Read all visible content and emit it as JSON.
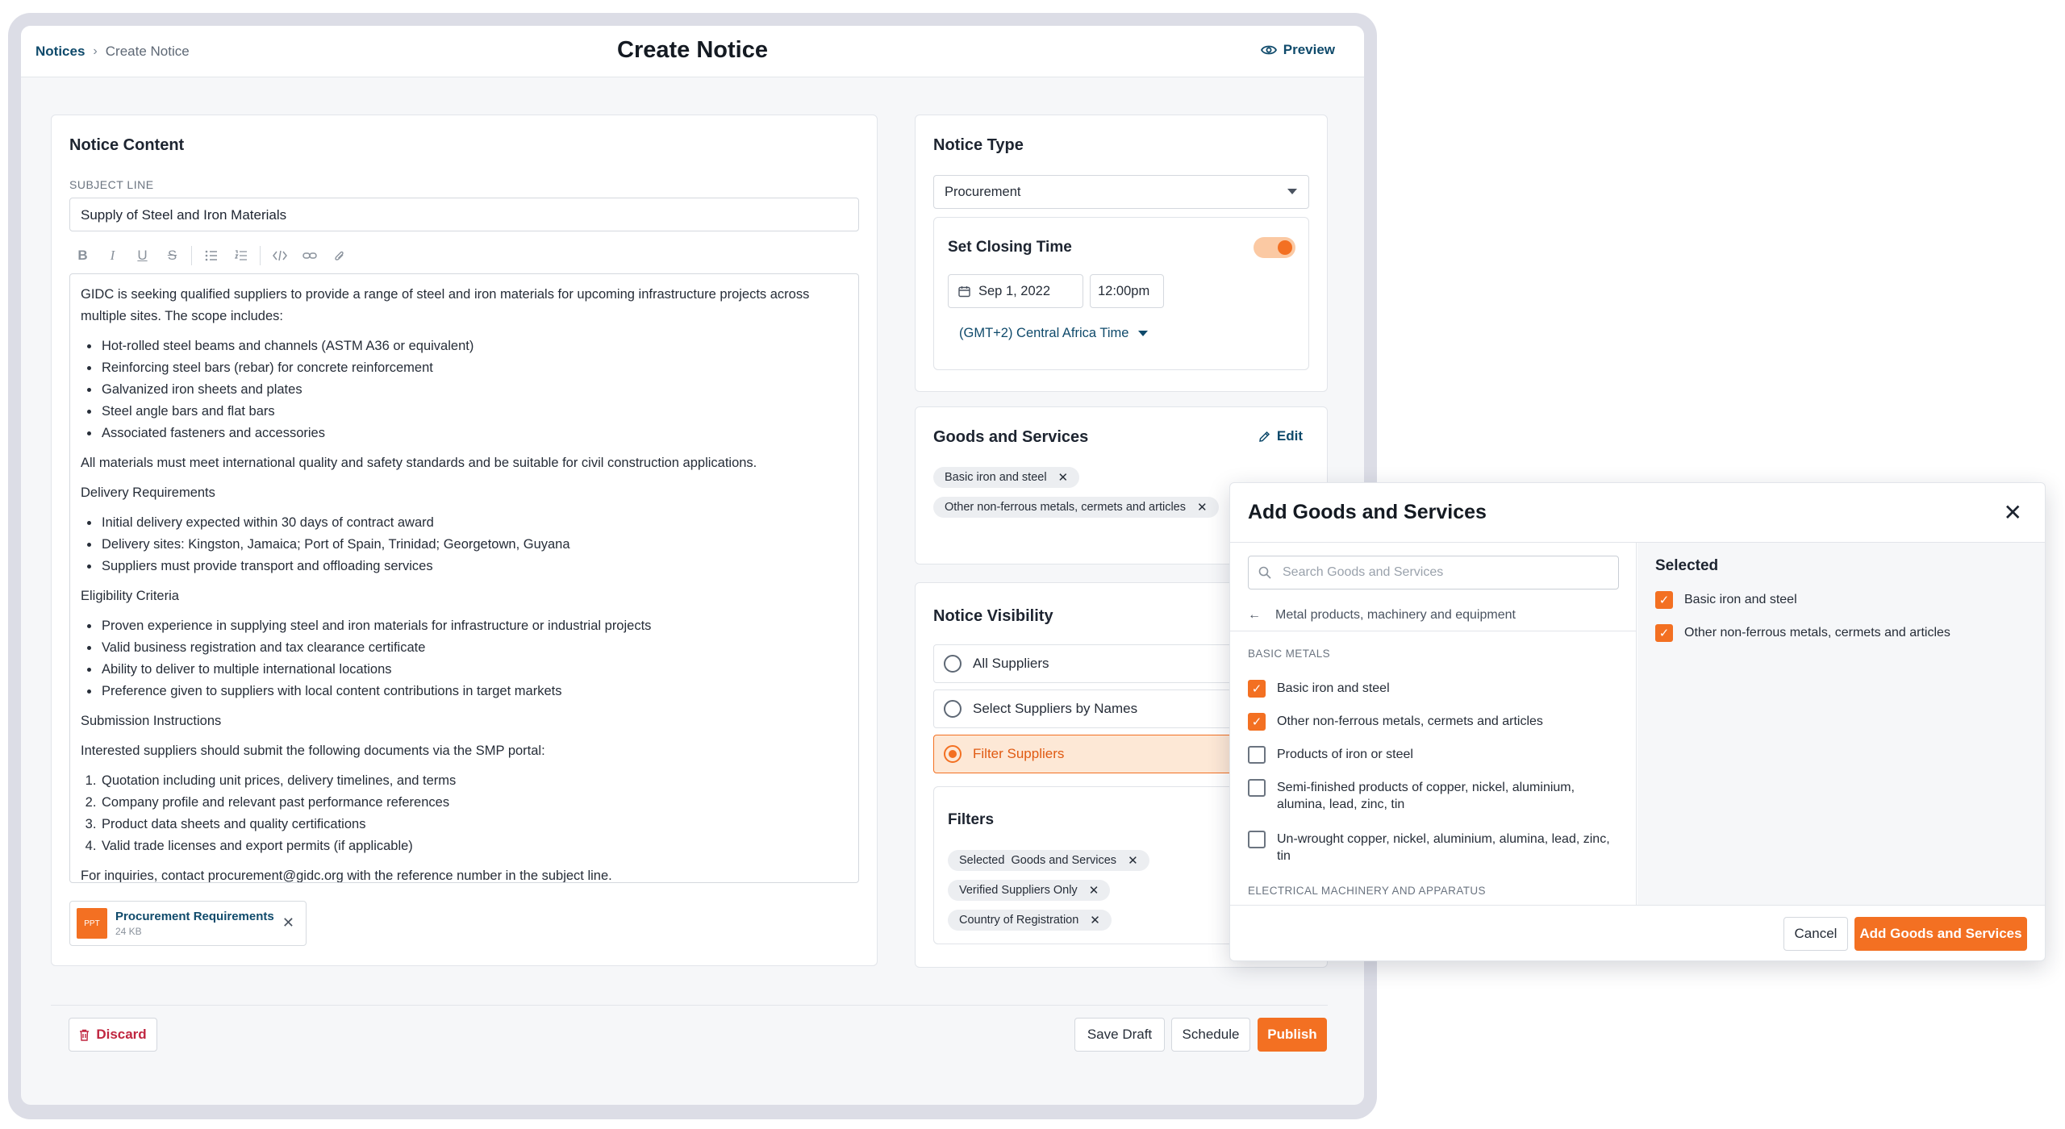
{
  "header": {
    "breadcrumb_root": "Notices",
    "breadcrumb_current": "Create Notice",
    "title": "Create Notice",
    "preview_label": "Preview"
  },
  "content": {
    "title": "Notice Content",
    "subject_label": "SUBJECT LINE",
    "subject_value": "Supply of Steel and Iron Materials",
    "toolbar_icons": [
      "bold-icon",
      "italic-icon",
      "underline-icon",
      "strikethrough-icon",
      "bullet-list-icon",
      "numbered-list-icon",
      "code-icon",
      "link-icon",
      "attachment-icon"
    ],
    "body": {
      "intro": "GIDC is seeking qualified suppliers to provide a range of steel and iron materials for upcoming infrastructure projects across multiple sites. The scope includes:",
      "scope": [
        "Hot-rolled steel beams and channels (ASTM A36 or equivalent)",
        "Reinforcing steel bars (rebar) for concrete reinforcement",
        "Galvanized iron sheets and plates",
        "Steel angle bars and flat bars",
        "Associated fasteners and accessories"
      ],
      "standards": "All materials must meet international quality and safety standards and be suitable for civil construction applications.",
      "delivery_heading": "Delivery Requirements",
      "delivery": [
        "Initial delivery expected within 30 days of contract award",
        "Delivery sites: Kingston, Jamaica; Port of Spain, Trinidad; Georgetown, Guyana",
        "Suppliers must provide transport and offloading services"
      ],
      "eligibility_heading": "Eligibility Criteria",
      "eligibility": [
        "Proven experience in supplying steel and iron materials for infrastructure or industrial projects",
        "Valid business registration and tax clearance certificate",
        "Ability to deliver to multiple international locations",
        "Preference given to suppliers with local content contributions in target markets"
      ],
      "submission_heading": "Submission Instructions",
      "submission_intro": "Interested suppliers should submit the following documents via the SMP portal:",
      "submission": [
        "Quotation including unit prices, delivery timelines, and terms",
        "Company profile and relevant past performance references",
        "Product data sheets and quality certifications",
        "Valid trade licenses and export permits (if applicable)"
      ],
      "inquiries": "For inquiries, contact procurement@gidc.org with the reference number in the subject line."
    },
    "attachment": {
      "type": "PPT",
      "name": "Procurement Requirements",
      "size": "24 KB"
    }
  },
  "notice_type": {
    "title": "Notice Type",
    "selected": "Procurement",
    "closing_title": "Set Closing Time",
    "closing_enabled": true,
    "date": "Sep 1, 2022",
    "time": "12:00pm",
    "timezone": "(GMT+2) Central Africa Time"
  },
  "goods": {
    "title": "Goods and Services",
    "edit_label": "Edit",
    "chips": [
      "Basic iron and steel",
      "Other non-ferrous metals, cermets and articles"
    ]
  },
  "visibility": {
    "title": "Notice Visibility",
    "options": [
      "All Suppliers",
      "Select Suppliers by Names",
      "Filter Suppliers"
    ],
    "selected_index": 2,
    "filters_title": "Filters",
    "filters": [
      "Selected  Goods and Services",
      "Verified Suppliers Only",
      "Country of Registration"
    ]
  },
  "footer": {
    "discard": "Discard",
    "save_draft": "Save Draft",
    "schedule": "Schedule",
    "publish": "Publish"
  },
  "modal": {
    "title": "Add Goods and Services",
    "search_placeholder": "Search Goods and Services",
    "back_category": "Metal products, machinery and equipment",
    "group1": "BASIC METALS",
    "items": [
      {
        "label": "Basic iron and steel",
        "checked": true
      },
      {
        "label": "Other non-ferrous metals, cermets and articles",
        "checked": true
      },
      {
        "label": "Products of iron or steel",
        "checked": false
      },
      {
        "label": "Semi-finished products of copper, nickel, aluminium, alumina, lead, zinc, tin",
        "checked": false
      },
      {
        "label": "Un-wrought copper, nickel, aluminium, alumina, lead, zinc, tin",
        "checked": false
      }
    ],
    "group2": "ELECTRICAL MACHINERY AND APPARATUS",
    "selected_title": "Selected",
    "selected": [
      "Basic iron and steel",
      "Other non-ferrous metals, cermets and articles"
    ],
    "cancel": "Cancel",
    "add": "Add Goods and Services"
  },
  "colors": {
    "accent": "#f37022",
    "link": "#0f4a6b",
    "danger": "#c02640"
  }
}
